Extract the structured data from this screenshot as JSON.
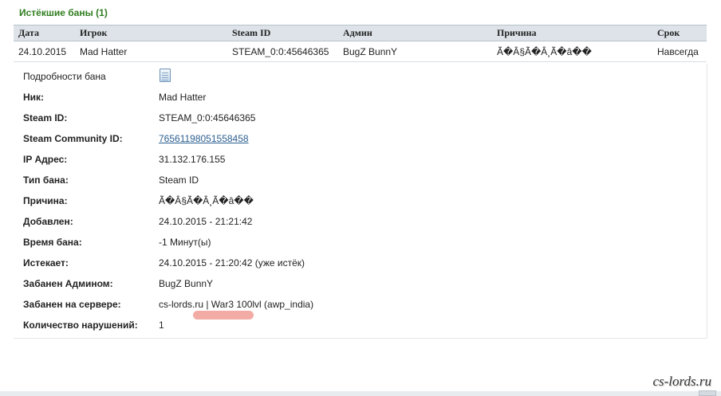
{
  "section_title": "Истёкшие баны (1)",
  "table": {
    "columns": [
      "Дата",
      "Игрок",
      "Steam ID",
      "Админ",
      "Причина",
      "Срок"
    ],
    "rows": [
      [
        "24.10.2015",
        "Mad Hatter",
        "STEAM_0:0:45646365",
        "BugZ BunnY",
        "Ã�Â§Ã�Â¸Ã�â��",
        "Навсегда"
      ]
    ]
  },
  "details": {
    "ban_details": {
      "label": "Подробности бана",
      "icon": "document-icon"
    },
    "nick": {
      "label": "Ник:",
      "value": "Mad Hatter"
    },
    "steam_id": {
      "label": "Steam ID:",
      "value": "STEAM_0:0:45646365"
    },
    "community_id": {
      "label": "Steam Community ID:",
      "value": "76561198051558458"
    },
    "ip": {
      "label": "IP Адрес:",
      "value": "31.132.176.155"
    },
    "ban_type": {
      "label": "Тип бана:",
      "value": "Steam ID"
    },
    "reason": {
      "label": "Причина:",
      "value": "Ã�Â§Ã�Â¸Ã�â��"
    },
    "added": {
      "label": "Добавлен:",
      "value": "24.10.2015 - 21:21:42"
    },
    "ban_time": {
      "label": "Время бана:",
      "value": "-1 Минут(ы)"
    },
    "expires": {
      "label": "Истекает:",
      "value": "24.10.2015 - 21:20:42 (уже истёк)"
    },
    "banned_by": {
      "label": "Забанен Админом:",
      "value": "BugZ BunnY"
    },
    "server": {
      "label": "Забанен на сервере:",
      "value": "cs-lords.ru | War3 100lvl (awp_india)"
    },
    "violations": {
      "label": "Количество нарушений:",
      "value": "1"
    }
  },
  "watermark": "cs-lords.ru",
  "colors": {
    "title_green": "#2f7d1e",
    "header_bg": "#dde3e8",
    "link": "#2a5d8f",
    "highlight": "#f2a39b"
  }
}
